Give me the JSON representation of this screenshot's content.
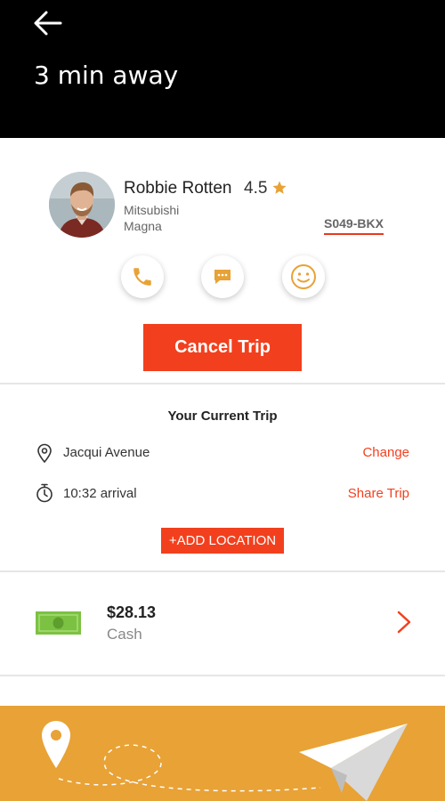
{
  "header": {
    "title": "3 min away",
    "back_icon": "arrow-left-icon"
  },
  "driver": {
    "name": "Robbie Rotten",
    "rating": "4.5",
    "car_make": "Mitsubishi",
    "car_model": "Magna",
    "plate": "S049-BKX"
  },
  "actions": {
    "call_icon": "phone-icon",
    "message_icon": "chat-icon",
    "rate_icon": "smiley-icon"
  },
  "cancel_label": "Cancel Trip",
  "trip": {
    "title": "Your  Current Trip",
    "destination": "Jacqui Avenue",
    "change_label": "Change",
    "arrival": "10:32 arrival",
    "share_label": "Share Trip",
    "add_location_label": "+ADD LOCATION"
  },
  "payment": {
    "amount": "$28.13",
    "method": "Cash"
  },
  "colors": {
    "accent": "#f2401e",
    "icon_gold": "#e8a236",
    "header_bg": "#000000",
    "cash_green": "#7cc242"
  }
}
